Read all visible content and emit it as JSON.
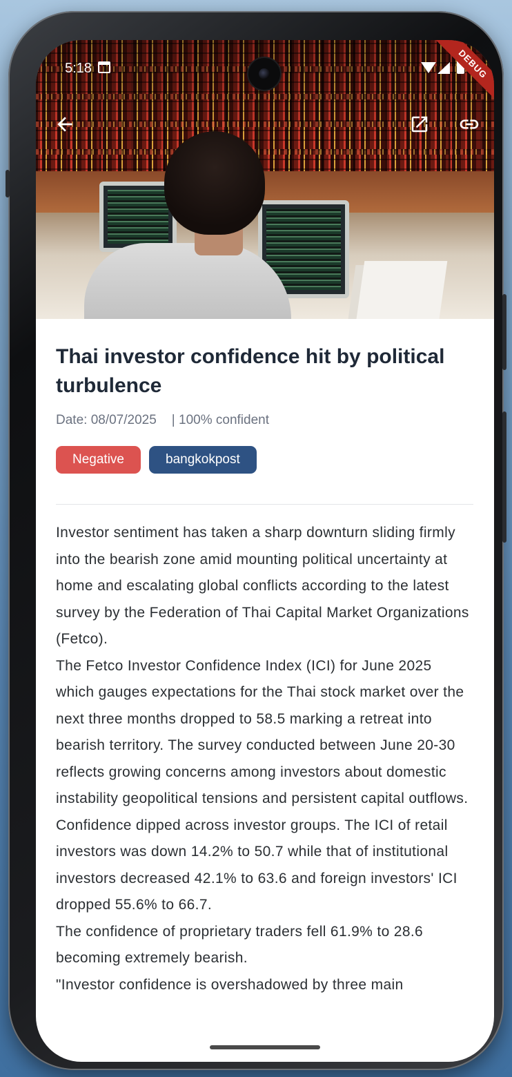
{
  "status_bar": {
    "time": "5:18",
    "debug_label": "DEBUG"
  },
  "appbar": {
    "back_icon": "arrow-left-icon",
    "open_external_icon": "open-in-new-icon",
    "link_icon": "link-icon"
  },
  "article": {
    "title": "Thai investor confidence hit by political turbulence",
    "date": "Date: 08/07/2025",
    "confidence": "| 100% confident",
    "tags": {
      "sentiment": "Negative",
      "source": "bangkokpost"
    },
    "body": "Investor sentiment has taken a sharp downturn sliding firmly into the bearish zone amid mounting political uncertainty at home and escalating global conflicts according to the latest survey by the Federation of Thai Capital Market Organizations (Fetco).\nThe Fetco Investor Confidence Index (ICI) for June 2025 which gauges expectations for the Thai stock market over the next three months dropped to 58.5 marking a retreat into bearish territory. The survey conducted between June 20-30 reflects growing concerns among investors about domestic instability geopolitical tensions and persistent capital outflows.\nConfidence dipped across investor groups. The ICI of retail investors was down 14.2% to 50.7 while that of institutional investors decreased 42.1% to 63.6 and foreign investors' ICI dropped 55.6% to 66.7.\nThe confidence of proprietary traders fell 61.9% to 28.6 becoming extremely bearish.\n\"Investor confidence is overshadowed by three main"
  },
  "colors": {
    "negative_tag": "#dc5350",
    "source_tag": "#2e5283",
    "title_text": "#1f2937",
    "meta_text": "#6b7280"
  }
}
